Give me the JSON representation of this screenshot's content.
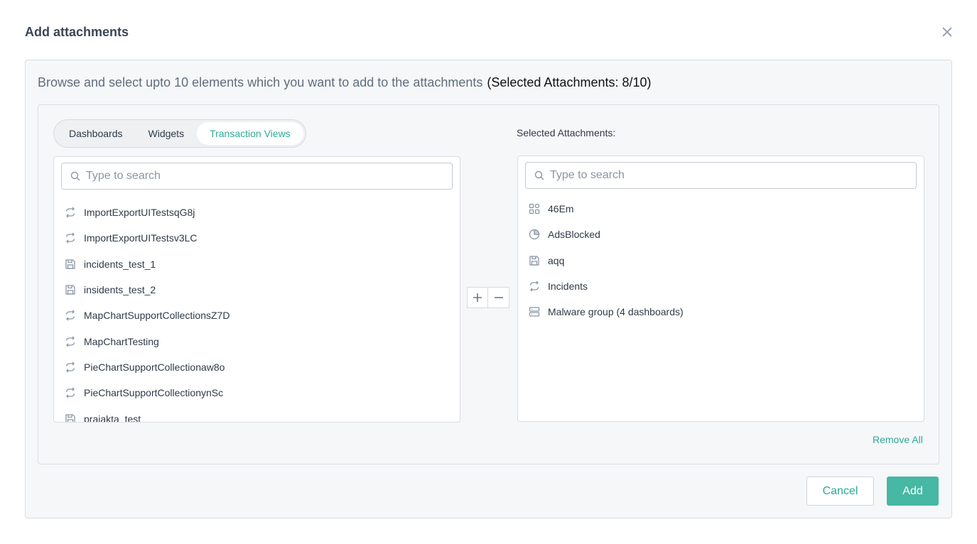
{
  "modal": {
    "title": "Add attachments",
    "instructions": "Browse and select upto 10 elements which you want to add to the attachments",
    "selected_count_text": "(Selected Attachments: 8/10)"
  },
  "tabs": [
    {
      "label": "Dashboards",
      "active": false
    },
    {
      "label": "Widgets",
      "active": false
    },
    {
      "label": "Transaction Views",
      "active": true
    }
  ],
  "left_list": {
    "search_placeholder": "Type to search",
    "items": [
      {
        "label": "ImportExportUITestsqG8j",
        "icon": "transaction-icon"
      },
      {
        "label": "ImportExportUITestsv3LC",
        "icon": "transaction-icon"
      },
      {
        "label": "incidents_test_1",
        "icon": "save-icon"
      },
      {
        "label": "insidents_test_2",
        "icon": "save-icon"
      },
      {
        "label": "MapChartSupportCollectionsZ7D",
        "icon": "transaction-icon"
      },
      {
        "label": "MapChartTesting",
        "icon": "transaction-icon"
      },
      {
        "label": "PieChartSupportCollectionaw8o",
        "icon": "transaction-icon"
      },
      {
        "label": "PieChartSupportCollectionynSc",
        "icon": "transaction-icon"
      },
      {
        "label": "prajakta_test",
        "icon": "save-icon"
      }
    ]
  },
  "right_list": {
    "label": "Selected Attachments:",
    "search_placeholder": "Type to search",
    "items": [
      {
        "label": "46Em",
        "icon": "widgets-icon"
      },
      {
        "label": "AdsBlocked",
        "icon": "pie-chart-icon"
      },
      {
        "label": "aqq",
        "icon": "save-icon"
      },
      {
        "label": "Incidents",
        "icon": "transaction-icon"
      },
      {
        "label": "Malware group (4 dashboards)",
        "icon": "dashboard-group-icon"
      }
    ],
    "remove_all": "Remove All"
  },
  "footer": {
    "cancel": "Cancel",
    "add": "Add"
  },
  "colors": {
    "accent": "#2fa996",
    "primary_button": "#46b8a4",
    "icon": "#8a96a3"
  }
}
